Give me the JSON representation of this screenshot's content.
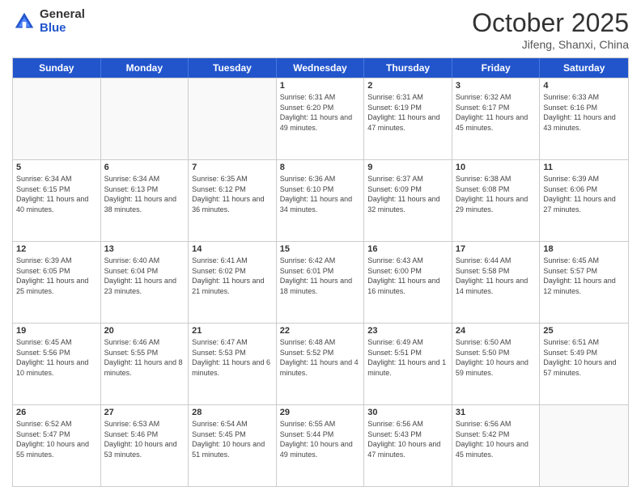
{
  "header": {
    "logo_general": "General",
    "logo_blue": "Blue",
    "month_title": "October 2025",
    "subtitle": "Jifeng, Shanxi, China"
  },
  "days_of_week": [
    "Sunday",
    "Monday",
    "Tuesday",
    "Wednesday",
    "Thursday",
    "Friday",
    "Saturday"
  ],
  "weeks": [
    [
      {
        "day": "",
        "sunrise": "",
        "sunset": "",
        "daylight": ""
      },
      {
        "day": "",
        "sunrise": "",
        "sunset": "",
        "daylight": ""
      },
      {
        "day": "",
        "sunrise": "",
        "sunset": "",
        "daylight": ""
      },
      {
        "day": "1",
        "sunrise": "Sunrise: 6:31 AM",
        "sunset": "Sunset: 6:20 PM",
        "daylight": "Daylight: 11 hours and 49 minutes."
      },
      {
        "day": "2",
        "sunrise": "Sunrise: 6:31 AM",
        "sunset": "Sunset: 6:19 PM",
        "daylight": "Daylight: 11 hours and 47 minutes."
      },
      {
        "day": "3",
        "sunrise": "Sunrise: 6:32 AM",
        "sunset": "Sunset: 6:17 PM",
        "daylight": "Daylight: 11 hours and 45 minutes."
      },
      {
        "day": "4",
        "sunrise": "Sunrise: 6:33 AM",
        "sunset": "Sunset: 6:16 PM",
        "daylight": "Daylight: 11 hours and 43 minutes."
      }
    ],
    [
      {
        "day": "5",
        "sunrise": "Sunrise: 6:34 AM",
        "sunset": "Sunset: 6:15 PM",
        "daylight": "Daylight: 11 hours and 40 minutes."
      },
      {
        "day": "6",
        "sunrise": "Sunrise: 6:34 AM",
        "sunset": "Sunset: 6:13 PM",
        "daylight": "Daylight: 11 hours and 38 minutes."
      },
      {
        "day": "7",
        "sunrise": "Sunrise: 6:35 AM",
        "sunset": "Sunset: 6:12 PM",
        "daylight": "Daylight: 11 hours and 36 minutes."
      },
      {
        "day": "8",
        "sunrise": "Sunrise: 6:36 AM",
        "sunset": "Sunset: 6:10 PM",
        "daylight": "Daylight: 11 hours and 34 minutes."
      },
      {
        "day": "9",
        "sunrise": "Sunrise: 6:37 AM",
        "sunset": "Sunset: 6:09 PM",
        "daylight": "Daylight: 11 hours and 32 minutes."
      },
      {
        "day": "10",
        "sunrise": "Sunrise: 6:38 AM",
        "sunset": "Sunset: 6:08 PM",
        "daylight": "Daylight: 11 hours and 29 minutes."
      },
      {
        "day": "11",
        "sunrise": "Sunrise: 6:39 AM",
        "sunset": "Sunset: 6:06 PM",
        "daylight": "Daylight: 11 hours and 27 minutes."
      }
    ],
    [
      {
        "day": "12",
        "sunrise": "Sunrise: 6:39 AM",
        "sunset": "Sunset: 6:05 PM",
        "daylight": "Daylight: 11 hours and 25 minutes."
      },
      {
        "day": "13",
        "sunrise": "Sunrise: 6:40 AM",
        "sunset": "Sunset: 6:04 PM",
        "daylight": "Daylight: 11 hours and 23 minutes."
      },
      {
        "day": "14",
        "sunrise": "Sunrise: 6:41 AM",
        "sunset": "Sunset: 6:02 PM",
        "daylight": "Daylight: 11 hours and 21 minutes."
      },
      {
        "day": "15",
        "sunrise": "Sunrise: 6:42 AM",
        "sunset": "Sunset: 6:01 PM",
        "daylight": "Daylight: 11 hours and 18 minutes."
      },
      {
        "day": "16",
        "sunrise": "Sunrise: 6:43 AM",
        "sunset": "Sunset: 6:00 PM",
        "daylight": "Daylight: 11 hours and 16 minutes."
      },
      {
        "day": "17",
        "sunrise": "Sunrise: 6:44 AM",
        "sunset": "Sunset: 5:58 PM",
        "daylight": "Daylight: 11 hours and 14 minutes."
      },
      {
        "day": "18",
        "sunrise": "Sunrise: 6:45 AM",
        "sunset": "Sunset: 5:57 PM",
        "daylight": "Daylight: 11 hours and 12 minutes."
      }
    ],
    [
      {
        "day": "19",
        "sunrise": "Sunrise: 6:45 AM",
        "sunset": "Sunset: 5:56 PM",
        "daylight": "Daylight: 11 hours and 10 minutes."
      },
      {
        "day": "20",
        "sunrise": "Sunrise: 6:46 AM",
        "sunset": "Sunset: 5:55 PM",
        "daylight": "Daylight: 11 hours and 8 minutes."
      },
      {
        "day": "21",
        "sunrise": "Sunrise: 6:47 AM",
        "sunset": "Sunset: 5:53 PM",
        "daylight": "Daylight: 11 hours and 6 minutes."
      },
      {
        "day": "22",
        "sunrise": "Sunrise: 6:48 AM",
        "sunset": "Sunset: 5:52 PM",
        "daylight": "Daylight: 11 hours and 4 minutes."
      },
      {
        "day": "23",
        "sunrise": "Sunrise: 6:49 AM",
        "sunset": "Sunset: 5:51 PM",
        "daylight": "Daylight: 11 hours and 1 minute."
      },
      {
        "day": "24",
        "sunrise": "Sunrise: 6:50 AM",
        "sunset": "Sunset: 5:50 PM",
        "daylight": "Daylight: 10 hours and 59 minutes."
      },
      {
        "day": "25",
        "sunrise": "Sunrise: 6:51 AM",
        "sunset": "Sunset: 5:49 PM",
        "daylight": "Daylight: 10 hours and 57 minutes."
      }
    ],
    [
      {
        "day": "26",
        "sunrise": "Sunrise: 6:52 AM",
        "sunset": "Sunset: 5:47 PM",
        "daylight": "Daylight: 10 hours and 55 minutes."
      },
      {
        "day": "27",
        "sunrise": "Sunrise: 6:53 AM",
        "sunset": "Sunset: 5:46 PM",
        "daylight": "Daylight: 10 hours and 53 minutes."
      },
      {
        "day": "28",
        "sunrise": "Sunrise: 6:54 AM",
        "sunset": "Sunset: 5:45 PM",
        "daylight": "Daylight: 10 hours and 51 minutes."
      },
      {
        "day": "29",
        "sunrise": "Sunrise: 6:55 AM",
        "sunset": "Sunset: 5:44 PM",
        "daylight": "Daylight: 10 hours and 49 minutes."
      },
      {
        "day": "30",
        "sunrise": "Sunrise: 6:56 AM",
        "sunset": "Sunset: 5:43 PM",
        "daylight": "Daylight: 10 hours and 47 minutes."
      },
      {
        "day": "31",
        "sunrise": "Sunrise: 6:56 AM",
        "sunset": "Sunset: 5:42 PM",
        "daylight": "Daylight: 10 hours and 45 minutes."
      },
      {
        "day": "",
        "sunrise": "",
        "sunset": "",
        "daylight": ""
      }
    ]
  ]
}
